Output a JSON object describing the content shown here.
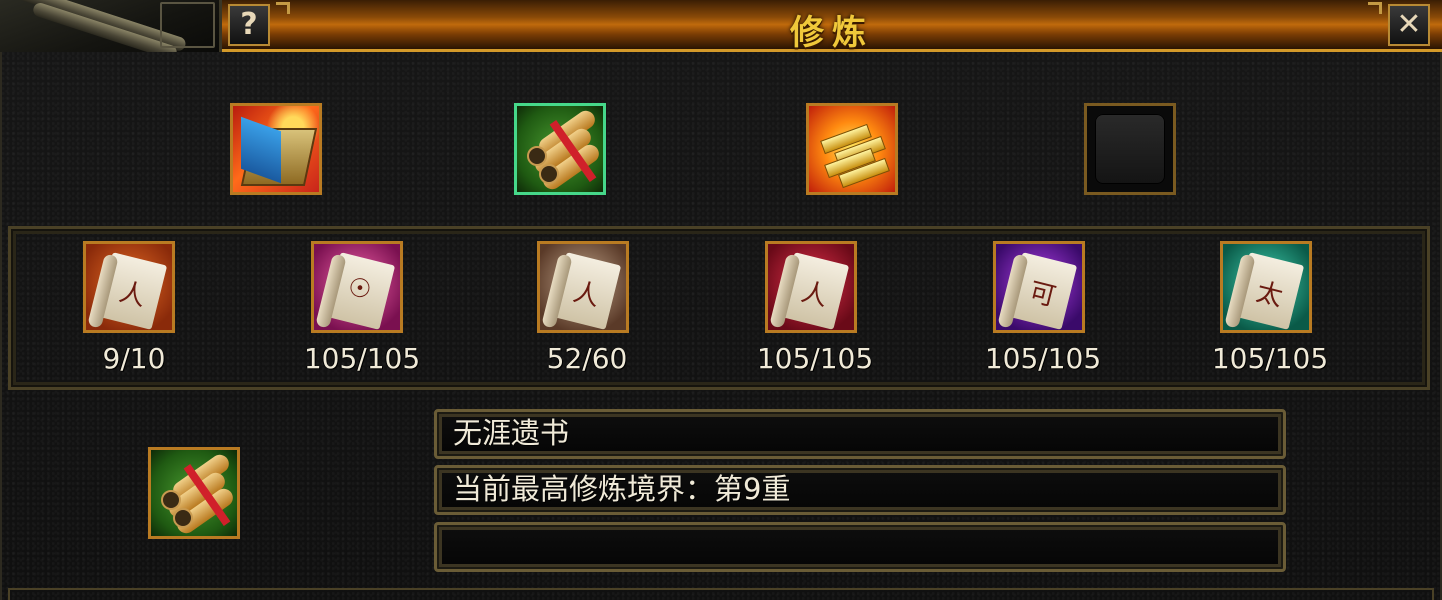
{
  "window": {
    "title": "修炼",
    "help_label": "?",
    "close_label": "✕"
  },
  "top_slots": [
    {
      "icon": "red-book-icon",
      "selected": false
    },
    {
      "icon": "scroll-bundle-icon",
      "selected": true
    },
    {
      "icon": "gold-bars-icon",
      "selected": false
    },
    {
      "icon": "empty-slot-icon",
      "selected": false
    }
  ],
  "scrolls": [
    {
      "icon": "orange-scroll-icon",
      "count": "9/10"
    },
    {
      "icon": "pink-scroll-icon",
      "count": "105/105"
    },
    {
      "icon": "brown-scroll-icon",
      "count": "52/60"
    },
    {
      "icon": "red-scroll-icon",
      "count": "105/105"
    },
    {
      "icon": "purple-scroll-icon",
      "count": "105/105"
    },
    {
      "icon": "teal-scroll-icon",
      "count": "105/105"
    }
  ],
  "detail": {
    "icon": "scroll-bundle-icon",
    "name": "无涯遗书",
    "status": "当前最高修炼境界：第9重",
    "extra": ""
  },
  "colors": {
    "accent_gold": "#f0c83a",
    "frame_bronze": "#b97b22",
    "selected_green": "#46d88a"
  }
}
